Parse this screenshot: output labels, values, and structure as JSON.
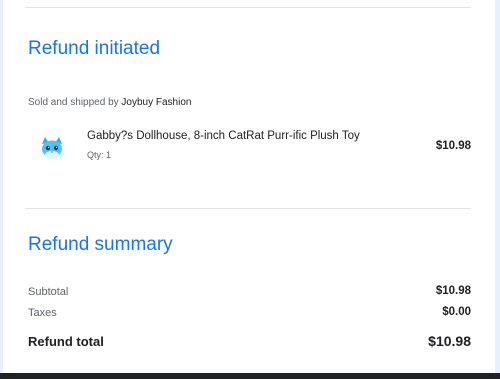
{
  "refund_initiated": {
    "heading": "Refund initiated",
    "seller_prefix": "Sold and shipped by ",
    "seller_name": "Joybuy Fashion",
    "item": {
      "thumbnail_icon": "cat-plush-icon",
      "name": "Gabby?s Dollhouse, 8-inch CatRat Purr-ific Plush Toy",
      "qty": "Qty: 1",
      "price": "$10.98"
    }
  },
  "refund_summary": {
    "heading": "Refund summary",
    "subtotal_label": "Subtotal",
    "subtotal_value": "$10.98",
    "taxes_label": "Taxes",
    "taxes_value": "$0.00",
    "total_label": "Refund total",
    "total_value": "$10.98"
  },
  "colors": {
    "accent": "#1a73e8",
    "background": "#e8f0fb"
  }
}
